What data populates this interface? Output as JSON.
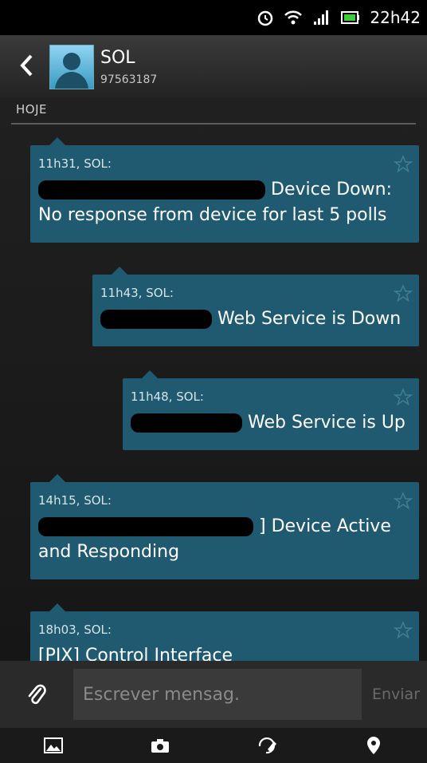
{
  "status_bar": {
    "time": "22h42",
    "icons": [
      "alarm-icon",
      "wifi-icon",
      "signal-icon",
      "battery-icon"
    ]
  },
  "header": {
    "contact_name": "SOL",
    "contact_number": "97563187"
  },
  "conversation": {
    "day_label": "HOJE",
    "messages": [
      {
        "meta": "11h31, SOL:",
        "text": "Device Down: No response from device for last 5 polls"
      },
      {
        "meta": "11h43, SOL:",
        "text": "Web Service is Down"
      },
      {
        "meta": "11h48, SOL:",
        "text": "Web Service is Up"
      },
      {
        "meta": "14h15, SOL:",
        "text": "] Device Active and Responding"
      },
      {
        "meta": "18h03, SOL:",
        "text": "[PIX] Control Interface"
      }
    ]
  },
  "composer": {
    "placeholder": "Escrever mensag.",
    "send_label": "Enviar"
  },
  "toolbar": {
    "icons": [
      "image-icon",
      "camera-icon",
      "draw-icon",
      "location-pin-icon"
    ]
  },
  "colors": {
    "bubble": "#1f5a70",
    "background": "#1c1c1c"
  }
}
